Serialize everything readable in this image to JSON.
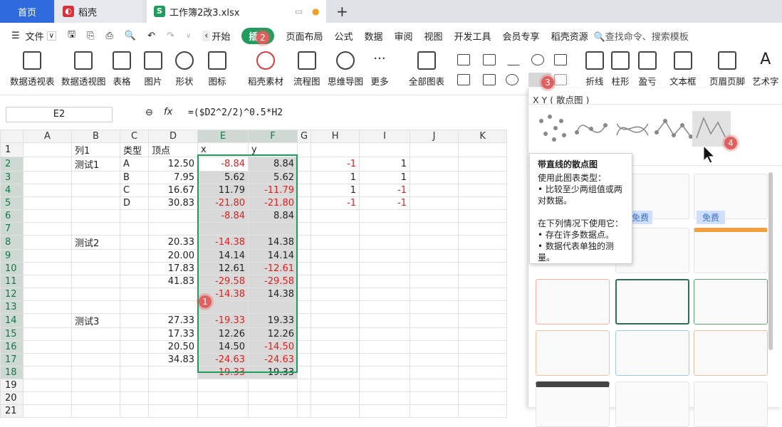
{
  "tabs": [
    {
      "label": "首页"
    },
    {
      "label": "稻壳"
    },
    {
      "label": "工作簿2改3.xlsx"
    }
  ],
  "menu": {
    "file": "文件",
    "items": [
      "开始",
      "插入",
      "页面布局",
      "公式",
      "数据",
      "审阅",
      "视图",
      "开发工具",
      "会员专享",
      "稻壳资源"
    ],
    "search_placeholder": "查找命令、搜索模板"
  },
  "ribbon": {
    "big": [
      "数据透视表",
      "数据透视图",
      "表格",
      "图片",
      "形状",
      "图标",
      "稻壳素材",
      "流程图",
      "思维导图",
      "更多",
      "全部图表",
      "折线",
      "柱形",
      "盈亏",
      "文本框",
      "页眉页脚",
      "艺术字"
    ]
  },
  "formula_bar": {
    "cell": "E2",
    "fx": "fx",
    "formula": "=($D2^2/2)^0.5*H2"
  },
  "columns": [
    "A",
    "B",
    "C",
    "D",
    "E",
    "F",
    "G",
    "H",
    "I",
    "J",
    "K"
  ],
  "rows": [
    [
      "",
      "列1",
      "类型",
      "顶点",
      "x",
      "y",
      "",
      "",
      "",
      "",
      ""
    ],
    [
      "",
      "测试1",
      "A",
      "12.50",
      "-8.84",
      "8.84",
      "",
      "-1",
      "1",
      "",
      ""
    ],
    [
      "",
      "",
      "B",
      "7.95",
      "5.62",
      "5.62",
      "",
      "1",
      "1",
      "",
      ""
    ],
    [
      "",
      "",
      "C",
      "16.67",
      "11.79",
      "-11.79",
      "",
      "1",
      "-1",
      "",
      ""
    ],
    [
      "",
      "",
      "D",
      "30.83",
      "-21.80",
      "-21.80",
      "",
      "-1",
      "-1",
      "",
      ""
    ],
    [
      "",
      "",
      "",
      "",
      "-8.84",
      "8.84",
      "",
      "",
      "",
      "",
      ""
    ],
    [
      "",
      "",
      "",
      "",
      "",
      "",
      "",
      "",
      "",
      "",
      ""
    ],
    [
      "",
      "测试2",
      "",
      "20.33",
      "-14.38",
      "14.38",
      "",
      "",
      "",
      "",
      ""
    ],
    [
      "",
      "",
      "",
      "20.00",
      "14.14",
      "14.14",
      "",
      "",
      "",
      "",
      ""
    ],
    [
      "",
      "",
      "",
      "17.83",
      "12.61",
      "-12.61",
      "",
      "",
      "",
      "",
      ""
    ],
    [
      "",
      "",
      "",
      "41.83",
      "-29.58",
      "-29.58",
      "",
      "",
      "",
      "",
      ""
    ],
    [
      "",
      "",
      "",
      "",
      "-14.38",
      "14.38",
      "",
      "",
      "",
      "",
      ""
    ],
    [
      "",
      "",
      "",
      "",
      "",
      "",
      "",
      "",
      "",
      "",
      ""
    ],
    [
      "",
      "测试3",
      "",
      "27.33",
      "-19.33",
      "19.33",
      "",
      "",
      "",
      "",
      ""
    ],
    [
      "",
      "",
      "",
      "17.33",
      "12.26",
      "12.26",
      "",
      "",
      "",
      "",
      ""
    ],
    [
      "",
      "",
      "",
      "20.50",
      "14.50",
      "-14.50",
      "",
      "",
      "",
      "",
      ""
    ],
    [
      "",
      "",
      "",
      "34.83",
      "-24.63",
      "-24.63",
      "",
      "",
      "",
      "",
      ""
    ],
    [
      "",
      "",
      "",
      "",
      "-19.33",
      "19.33",
      "",
      "",
      "",
      "",
      ""
    ],
    [
      "",
      "",
      "",
      "",
      "",
      "",
      "",
      "",
      "",
      "",
      ""
    ],
    [
      "",
      "",
      "",
      "",
      "",
      "",
      "",
      "",
      "",
      "",
      ""
    ],
    [
      "",
      "",
      "",
      "",
      "",
      "",
      "",
      "",
      "",
      "",
      ""
    ]
  ],
  "panel": {
    "title": "X Y ( 散点图 )",
    "free": "免费"
  },
  "tooltip": {
    "title": "带直线的散点图",
    "l1": "使用此图表类型：",
    "l2": "• 比较至少两组值或两对数据。",
    "l3": "在下列情况下使用它：",
    "l4": "• 存在许多数据点。",
    "l5": "• 数据代表单独的测量。"
  },
  "badges": [
    "1",
    "2",
    "3",
    "4"
  ],
  "colors": {
    "accent": "#1f9c5e",
    "negative": "#e02020",
    "home_tab": "#2f6bdc"
  }
}
